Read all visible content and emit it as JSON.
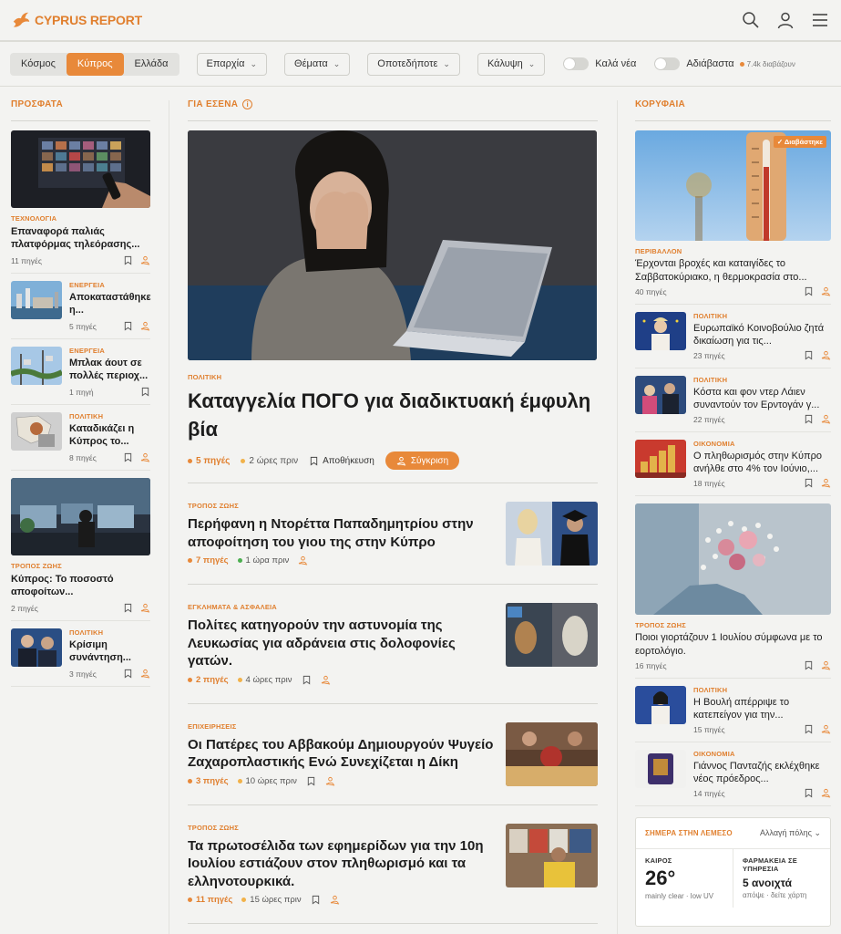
{
  "brand": {
    "name": "CYPRUS REPORT",
    "accent": "#e8893a"
  },
  "header": {
    "icons": [
      "search-icon",
      "user-icon",
      "menu-icon"
    ]
  },
  "filters": {
    "scope": [
      "Κόσμος",
      "Κύπρος",
      "Ελλάδα"
    ],
    "scope_selected": "Κύπρος",
    "dropdowns": [
      "Επαρχία",
      "Θέματα",
      "Οποτεδήποτε",
      "Κάλυψη"
    ],
    "toggles": [
      "Καλά νέα",
      "Αδιάβαστα"
    ],
    "readers": "7.4k διαβάζουν"
  },
  "left": {
    "title": "ΠΡΟΣΦΑΤΑ",
    "featured": [
      {
        "category": "ΤΕΧΝΟΛΟΓΙΑ",
        "title": "Επαναφορά παλιάς πλατφόρμας τηλεόρασης...",
        "sources": "11 πηγές"
      }
    ],
    "items": [
      {
        "category": "ΕΝΕΡΓΕΙΑ",
        "title": "Αποκαταστάθηκε η...",
        "sources": "5 πηγές"
      },
      {
        "category": "ΕΝΕΡΓΕΙΑ",
        "title": "Μπλακ άουτ σε πολλές περιοχ...",
        "sources": "1 πηγή"
      },
      {
        "category": "ΠΟΛΙΤΙΚΗ",
        "title": "Καταδικάζει η Κύπρος το...",
        "sources": "8 πηγές"
      }
    ],
    "featured2": {
      "category": "ΤΡΟΠΟΣ ΖΩΗΣ",
      "title": "Κύπρος: Το ποσοστό αποφοίτων...",
      "sources": "2 πηγές"
    },
    "items2": [
      {
        "category": "ΠΟΛΙΤΙΚΗ",
        "title": "Κρίσιμη συνάντηση...",
        "sources": "3 πηγές"
      }
    ]
  },
  "middle": {
    "title": "ΓΙΑ ΕΣΕΝΑ",
    "hero": {
      "category": "ΠΟΛΙΤΙΚΗ",
      "title": "Καταγγελία ΠΟΓΟ για διαδικτυακή έμφυλη βία",
      "sources": "5 πηγές",
      "time": "2 ώρες πριν",
      "save": "Αποθήκευση",
      "compare": "Σύγκριση"
    },
    "items": [
      {
        "category": "ΤΡΟΠΟΣ ΖΩΗΣ",
        "title": "Περήφανη η Ντορέττα Παπαδημητρίου στην αποφοίτηση του γιου της στην Κύπρο",
        "sources": "7 πηγές",
        "time": "1 ώρα πριν",
        "dot": "g"
      },
      {
        "category": "ΕΓΚΛΗΜΑΤΑ & ΑΣΦΑΛΕΙΑ",
        "title": "Πολίτες κατηγορούν την αστυνομία της Λευκωσίας για αδράνεια στις δολοφονίες γατών.",
        "sources": "2 πηγές",
        "time": "4 ώρες πριν",
        "dot": "y"
      },
      {
        "category": "ΕΠΙΧΕΙΡΗΣΕΙΣ",
        "title": "Οι Πατέρες του Αββακούμ Δημιουργούν Ψυγείο Ζαχαροπλαστικής Ενώ Συνεχίζεται η Δίκη",
        "sources": "3 πηγές",
        "time": "10 ώρες πριν",
        "dot": "y"
      },
      {
        "category": "ΤΡΟΠΟΣ ΖΩΗΣ",
        "title": "Τα πρωτοσέλιδα των εφημερίδων για την 10η Ιουλίου εστιάζουν στον πληθωρισμό και τα ελληνοτουρκικά.",
        "sources": "11 πηγές",
        "time": "15 ώρες πριν",
        "dot": "y"
      }
    ]
  },
  "right": {
    "title": "ΚΟΡΥΦΑΙΑ",
    "featured": {
      "category": "ΠΕΡΙΒΑΛΛΟΝ",
      "title": "Έρχονται βροχές και καταιγίδες το Σαββατοκύριακο, η θερμοκρασία στο...",
      "sources": "40 πηγές",
      "badge": "✓ Διαβάστηκε"
    },
    "items": [
      {
        "category": "ΠΟΛΙΤΙΚΗ",
        "title": "Ευρωπαϊκό Κοινοβούλιο ζητά δικαίωση για τις...",
        "sources": "23 πηγές"
      },
      {
        "category": "ΠΟΛΙΤΙΚΗ",
        "title": "Κόστα και φον ντερ Λάιεν συναντούν τον Ερντογάν γ...",
        "sources": "22 πηγές"
      },
      {
        "category": "ΟΙΚΟΝΟΜΙΑ",
        "title": "Ο πληθωρισμός στην Κύπρο ανήλθε στο 4% τον Ιούνιο,...",
        "sources": "18 πηγές"
      }
    ],
    "featured2": {
      "category": "ΤΡΟΠΟΣ ΖΩΗΣ",
      "title": "Ποιοι γιορτάζουν 1 Ιουλίου σύμφωνα με το εορτολόγιο.",
      "sources": "16 πηγές"
    },
    "items2": [
      {
        "category": "ΠΟΛΙΤΙΚΗ",
        "title": "Η Βουλή απέρριψε το κατεπείγον για την...",
        "sources": "15 πηγές"
      },
      {
        "category": "ΟΙΚΟΝΟΜΙΑ",
        "title": "Γιάννος Πανταζής εκλέχθηκε νέος πρόεδρος...",
        "sources": "14 πηγές"
      }
    ]
  },
  "weather": {
    "title": "ΣΗΜΕΡΑ ΣΤΗΝ ΛΕΜΕΣΟ",
    "change_city": "Αλλαγή πόλης",
    "weather_label": "ΚΑΙΡΟΣ",
    "temp": "26°",
    "condition": "mainly clear · low UV",
    "pharmacy_label": "ΦΑΡΜΑΚΕΙΑ ΣΕ ΥΠΗΡΕΣΙΑ",
    "pharmacy_value": "5 ανοιχτά",
    "pharmacy_sub": "απόψε · δείτε χάρτη"
  }
}
